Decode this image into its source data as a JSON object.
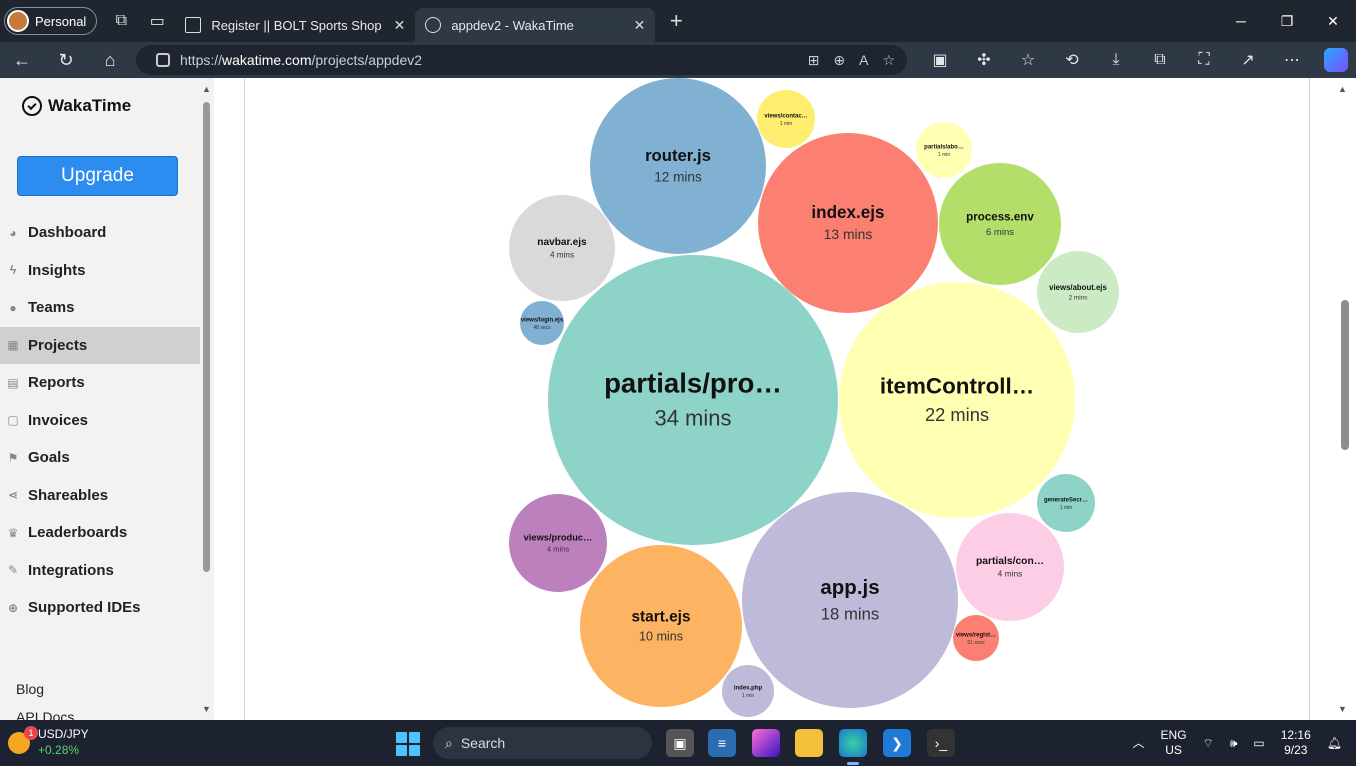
{
  "browser": {
    "profile_label": "Personal",
    "tabs": [
      {
        "title": "Register || BOLT Sports Shop"
      },
      {
        "title": "appdev2 - WakaTime"
      }
    ],
    "url_prefix": "https://",
    "url_host": "wakatime.com",
    "url_path": "/projects/appdev2"
  },
  "sidebar": {
    "logo_text": "WakaTime",
    "upgrade_label": "Upgrade",
    "items": [
      {
        "label": "Dashboard",
        "icon": "palette-icon"
      },
      {
        "label": "Insights",
        "icon": "bolt-icon"
      },
      {
        "label": "Teams",
        "icon": "users-icon"
      },
      {
        "label": "Projects",
        "icon": "grid-icon"
      },
      {
        "label": "Reports",
        "icon": "file-pdf-icon"
      },
      {
        "label": "Invoices",
        "icon": "file-icon"
      },
      {
        "label": "Goals",
        "icon": "flag-icon"
      },
      {
        "label": "Shareables",
        "icon": "share-icon"
      },
      {
        "label": "Leaderboards",
        "icon": "trophy-icon"
      },
      {
        "label": "Integrations",
        "icon": "wrench-icon"
      },
      {
        "label": "Supported IDEs",
        "icon": "plus-circle-icon"
      }
    ],
    "footer_links": [
      "Blog",
      "API Docs"
    ]
  },
  "chart_data": {
    "type": "bubble",
    "bubbles": [
      {
        "label": "partials/pro…",
        "value": "34 mins",
        "color": "#8ed3c7"
      },
      {
        "label": "itemControll…",
        "value": "22 mins",
        "color": "#ffffb3"
      },
      {
        "label": "app.js",
        "value": "18 mins",
        "color": "#bebada"
      },
      {
        "label": "index.ejs",
        "value": "13 mins",
        "color": "#fb8072"
      },
      {
        "label": "router.js",
        "value": "12 mins",
        "color": "#80b1d3"
      },
      {
        "label": "start.ejs",
        "value": "10 mins",
        "color": "#fdb462"
      },
      {
        "label": "process.env",
        "value": "6 mins",
        "color": "#b3de69"
      },
      {
        "label": "navbar.ejs",
        "value": "4 mins",
        "color": "#d9d9d9"
      },
      {
        "label": "views/produc…",
        "value": "4 mins",
        "color": "#bc80bd"
      },
      {
        "label": "partials/con…",
        "value": "4 mins",
        "color": "#fccde5"
      },
      {
        "label": "views/about.ejs",
        "value": "2 mins",
        "color": "#ccebc5"
      },
      {
        "label": "views/contac…",
        "value": "1 min",
        "color": "#ffed6f"
      },
      {
        "label": "partials/abo…",
        "value": "1 min",
        "color": "#ffffb3"
      },
      {
        "label": "generateSecr…",
        "value": "1 min",
        "color": "#8dd3c7"
      },
      {
        "label": "index.php",
        "value": "1 min",
        "color": "#bebada"
      },
      {
        "label": "views/regist…",
        "value": "51 secs",
        "color": "#fb8072"
      },
      {
        "label": "views/login.ejs",
        "value": "48 secs",
        "color": "#80b1d3"
      }
    ]
  },
  "taskbar": {
    "weather_title": "USD/JPY",
    "weather_change": "+0.28%",
    "weather_badge": "1",
    "search_label": "Search",
    "lang_top": "ENG",
    "lang_bottom": "US",
    "time": "12:16",
    "date": "9/23"
  }
}
